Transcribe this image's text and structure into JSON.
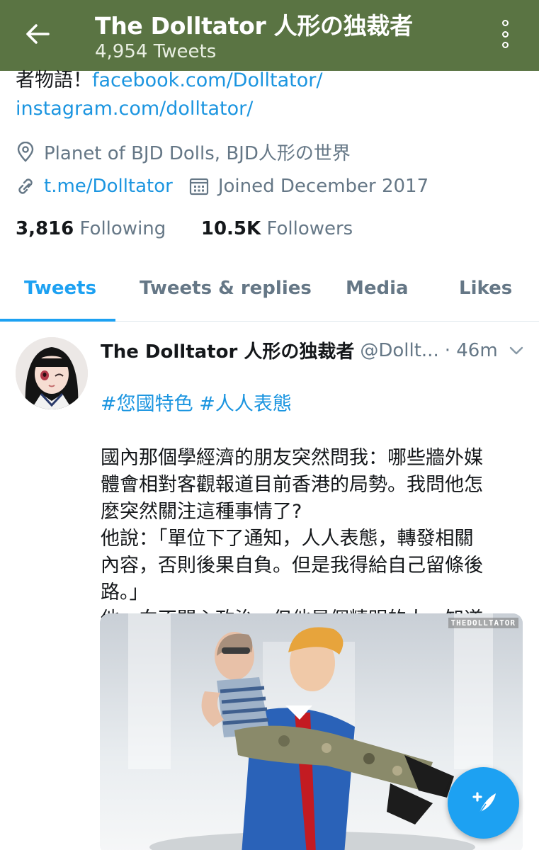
{
  "topbar": {
    "back_icon": "arrow-left-icon",
    "title": "The Dolltator 人形の独裁者",
    "tweet_count": "4,954 Tweets",
    "more_icon": "more-vertical-icon",
    "background": "#5a7443"
  },
  "bio": {
    "text_prefix": "者物語！",
    "links": [
      "facebook.com/Dolltator/",
      "instagram.com/dolltator/"
    ]
  },
  "profile": {
    "location_icon": "location-pin-icon",
    "location": "Planet of BJD Dolls, BJD人形の世界",
    "link_icon": "link-icon",
    "link": "t.me/Dolltator",
    "calendar_icon": "calendar-icon",
    "joined": "Joined December 2017"
  },
  "stats": {
    "following_count": "3,816",
    "following_label": "Following",
    "followers_count": "10.5K",
    "followers_label": "Followers"
  },
  "tabs": [
    {
      "label": "Tweets",
      "active": true
    },
    {
      "label": "Tweets & replies",
      "active": false
    },
    {
      "label": "Media",
      "active": false
    },
    {
      "label": "Likes",
      "active": false
    }
  ],
  "tweet": {
    "name": "The Dolltator 人形の独裁者",
    "handle": "@Dollt...",
    "time": "· 46m",
    "hashtags": [
      "#您國特色",
      "#人人表態"
    ],
    "body": "國內那個學經濟的朋友突然問我：哪些牆外媒\n體會相對客觀報道目前香港的局勢。我問他怎\n麼突然關注這種事情了?\n他說：「單位下了通知，人人表態，轉發相關\n內容，否則後果自負。但是我得給自己留條後\n路。」\n他一向不關心政治，但他是個精明的人，知道\n強買強賣是不可能長久的。",
    "media_watermark": "THEDOLLTATOR",
    "caret_icon": "chevron-down-icon"
  },
  "fab": {
    "icon": "compose-feather-icon"
  },
  "colors": {
    "accent": "#1da1f2",
    "link": "#1b95e0",
    "muted": "#657786"
  }
}
